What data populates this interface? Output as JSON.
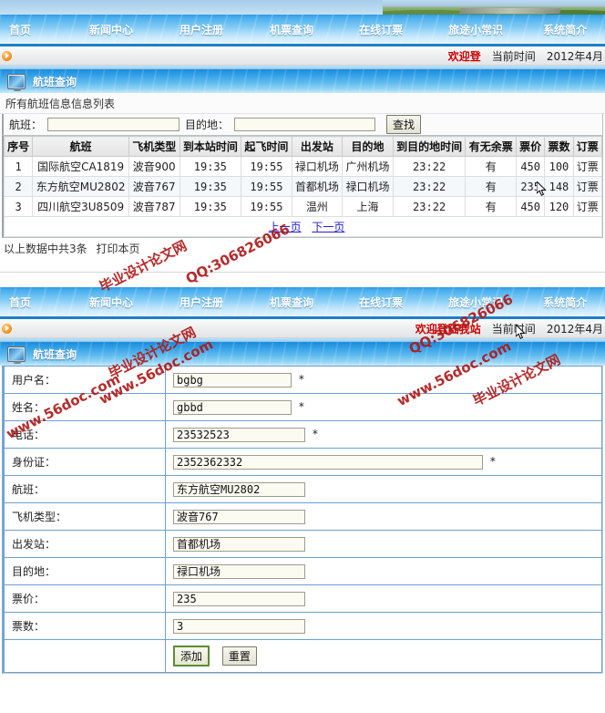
{
  "site": {
    "nav_items": [
      "首页",
      "新闻中心",
      "用户注册",
      "机票查询",
      "在线订票",
      "旅途小常识",
      "系统简介"
    ],
    "welcome_top": "欢迎登",
    "welcome_bottom": "欢迎登陆我站",
    "time_label": "当前时间",
    "time_value": "2012年4月",
    "arrow_icon": "orange-arrow-icon"
  },
  "panel1": {
    "title": "航班查询",
    "icon": "monitor-icon",
    "caption": "所有航班信息信息列表",
    "search": {
      "flight_label": "航班：",
      "flight_value": "",
      "flight_placeholder": "",
      "dest_label": "目的地：",
      "dest_value": "",
      "dest_placeholder": "",
      "button": "查找"
    },
    "table": {
      "headers": [
        "序号",
        "航班",
        "飞机类型",
        "到本站时间",
        "起飞时间",
        "出发站",
        "目的地",
        "到目的地时间",
        "有无余票",
        "票价",
        "票数",
        "订票"
      ],
      "rows": [
        [
          "1",
          "国际航空CA1819",
          "波音900",
          "19:35",
          "19:55",
          "禄口机场",
          "广州机场",
          "23:22",
          "有",
          "450",
          "100",
          "订票"
        ],
        [
          "2",
          "东方航空MU2802",
          "波音767",
          "19:35",
          "19:55",
          "首都机场",
          "禄口机场",
          "23:22",
          "有",
          "235",
          "148",
          "订票"
        ],
        [
          "3",
          "四川航空3U8509",
          "波音787",
          "19:35",
          "19:55",
          "温州",
          "上海",
          "23:22",
          "有",
          "450",
          "120",
          "订票"
        ]
      ],
      "prev_page": "上一页",
      "next_page": "下一页"
    },
    "footnote_text": "以上数据中共3条",
    "footnote_link": "打印本页"
  },
  "panel2": {
    "title": "航班查询",
    "icon": "monitor-icon",
    "fields": [
      {
        "label": "用户名：",
        "value": "bgbg",
        "required": "*",
        "width": "w-short"
      },
      {
        "label": "姓名：",
        "value": "gbbd",
        "required": "*",
        "width": "w-short"
      },
      {
        "label": "电话：",
        "value": "23532523",
        "required": "*",
        "width": "w-mid"
      },
      {
        "label": "身份证：",
        "value": "2352362332",
        "required": "*",
        "width": "w-long"
      },
      {
        "label": "航班：",
        "value": "东方航空MU2802",
        "required": "",
        "width": "w-mid"
      },
      {
        "label": "飞机类型：",
        "value": "波音767",
        "required": "",
        "width": "w-mid"
      },
      {
        "label": "出发站：",
        "value": "首都机场",
        "required": "",
        "width": "w-mid"
      },
      {
        "label": "目的地：",
        "value": "禄口机场",
        "required": "",
        "width": "w-mid"
      },
      {
        "label": "票价：",
        "value": "235",
        "required": "",
        "width": "w-mid"
      },
      {
        "label": "票数：",
        "value": "3",
        "required": "",
        "width": "w-mid"
      }
    ],
    "submit_button": "添加",
    "reset_button": "重置"
  },
  "watermarks": {
    "site_url": "www.56doc.com",
    "brand": "毕业设计论文网",
    "qq": "QQ:306826066"
  },
  "colors": {
    "nav_blue": "#2f9ae4",
    "accent_red": "#cc0000",
    "link_blue": "#2222cc",
    "watermark_red": "#b01818"
  }
}
